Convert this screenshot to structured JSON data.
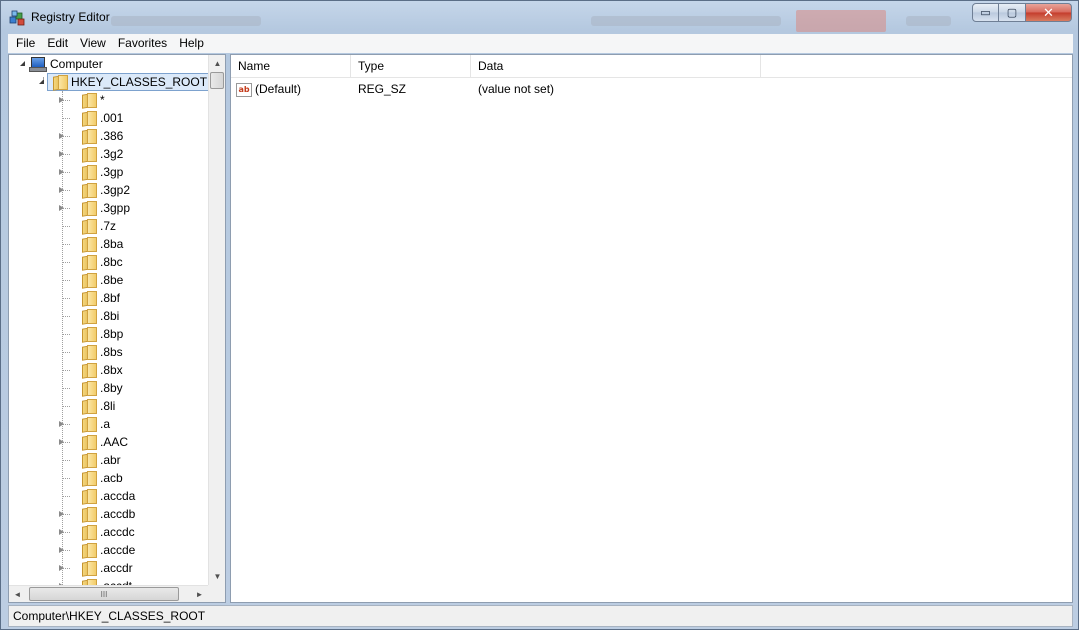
{
  "window": {
    "title": "Registry Editor",
    "caption_buttons": {
      "minimize": "▭",
      "maximize": "▢",
      "close": "✕"
    }
  },
  "menu": [
    "File",
    "Edit",
    "View",
    "Favorites",
    "Help"
  ],
  "tree": {
    "root_label": "Computer",
    "hive_label": "HKEY_CLASSES_ROOT",
    "keys": [
      {
        "label": "*",
        "expandable": true
      },
      {
        "label": ".001",
        "expandable": false
      },
      {
        "label": ".386",
        "expandable": true
      },
      {
        "label": ".3g2",
        "expandable": true
      },
      {
        "label": ".3gp",
        "expandable": true
      },
      {
        "label": ".3gp2",
        "expandable": true
      },
      {
        "label": ".3gpp",
        "expandable": true
      },
      {
        "label": ".7z",
        "expandable": false
      },
      {
        "label": ".8ba",
        "expandable": false
      },
      {
        "label": ".8bc",
        "expandable": false
      },
      {
        "label": ".8be",
        "expandable": false
      },
      {
        "label": ".8bf",
        "expandable": false
      },
      {
        "label": ".8bi",
        "expandable": false
      },
      {
        "label": ".8bp",
        "expandable": false
      },
      {
        "label": ".8bs",
        "expandable": false
      },
      {
        "label": ".8bx",
        "expandable": false
      },
      {
        "label": ".8by",
        "expandable": false
      },
      {
        "label": ".8li",
        "expandable": false
      },
      {
        "label": ".a",
        "expandable": true
      },
      {
        "label": ".AAC",
        "expandable": true
      },
      {
        "label": ".abr",
        "expandable": false
      },
      {
        "label": ".acb",
        "expandable": false
      },
      {
        "label": ".accda",
        "expandable": false
      },
      {
        "label": ".accdb",
        "expandable": true
      },
      {
        "label": ".accdc",
        "expandable": true
      },
      {
        "label": ".accde",
        "expandable": true
      },
      {
        "label": ".accdr",
        "expandable": true
      },
      {
        "label": ".accdt",
        "expandable": true
      }
    ],
    "scroll": {
      "up": "▲",
      "down": "▼",
      "left": "◄",
      "right": "►",
      "grip": "III"
    }
  },
  "list": {
    "columns": [
      "Name",
      "Type",
      "Data"
    ],
    "rows": [
      {
        "icon": "string-value-icon",
        "icon_text": "ab",
        "name": "(Default)",
        "type": "REG_SZ",
        "data": "(value not set)"
      }
    ]
  },
  "status": {
    "path": "Computer\\HKEY_CLASSES_ROOT"
  }
}
